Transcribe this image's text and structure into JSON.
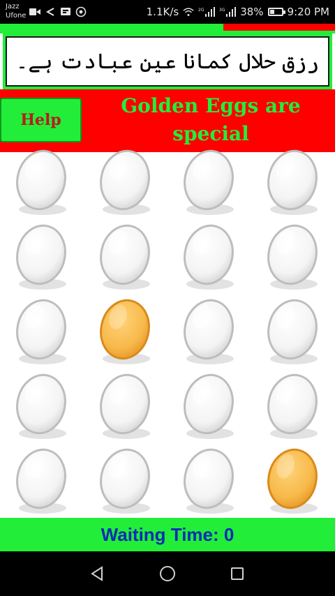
{
  "status_bar": {
    "carrier_line1": "Jazz",
    "carrier_line2": "Ufone",
    "speed": "1.1K/s",
    "network1": "2G",
    "network2": "3G",
    "battery": "38%",
    "battery_level": 0.38,
    "time": "9:20 PM"
  },
  "banner": {
    "text_main": "رزق حلال کمانا عین عبادت ہے۔",
    "colors": {
      "accent": "#d40000",
      "text": "#000000"
    }
  },
  "header": {
    "help_label": "Help",
    "title": "Golden Eggs are special"
  },
  "eggs": [
    [
      "white",
      "white",
      "white",
      "white"
    ],
    [
      "white",
      "white",
      "white",
      "white"
    ],
    [
      "white",
      "golden",
      "white",
      "white"
    ],
    [
      "white",
      "white",
      "white",
      "white"
    ],
    [
      "white",
      "white",
      "white",
      "golden"
    ]
  ],
  "footer": {
    "waiting_label": "Waiting Time: 0"
  },
  "colors": {
    "green": "#22ee3a",
    "red": "#ff0000",
    "blue_text": "#0b2bb5",
    "golden_egg": "#f7b94a",
    "white_egg": "#f4f4f4"
  },
  "nav": {
    "icons": [
      "back-icon",
      "home-icon",
      "recents-icon"
    ]
  }
}
